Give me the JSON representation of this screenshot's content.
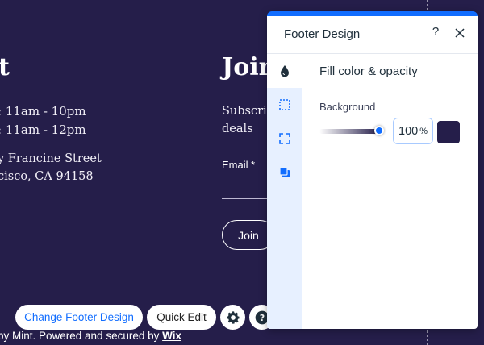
{
  "colors": {
    "background": "#251e4a",
    "accent": "#116dff",
    "swatch": "#251e4a"
  },
  "site": {
    "left_heading": "t",
    "hours": [
      ": 11am - 10pm",
      ": 11am - 12pm"
    ],
    "address": [
      "y Francine Street",
      "cisco, CA 94158"
    ],
    "join_heading": "Join",
    "subscribe_lines": [
      "Subscribe",
      "deals"
    ],
    "email_label": "Email *",
    "join_button": "Join",
    "credit_prefix": "by Mint. Powered and secured by ",
    "credit_link": "Wix"
  },
  "toolbar": {
    "change_design": "Change Footer Design",
    "quick_edit": "Quick Edit",
    "settings_icon": "gear-icon",
    "help_icon": "help-icon"
  },
  "panel": {
    "title": "Footer Design",
    "help": "?",
    "rail": [
      "fill-drop-icon",
      "border-icon",
      "corners-icon",
      "shadow-icon"
    ],
    "section_title": "Fill color & opacity",
    "background_label": "Background",
    "opacity_value": "100",
    "opacity_unit": "%",
    "opacity_level": 1.0
  }
}
